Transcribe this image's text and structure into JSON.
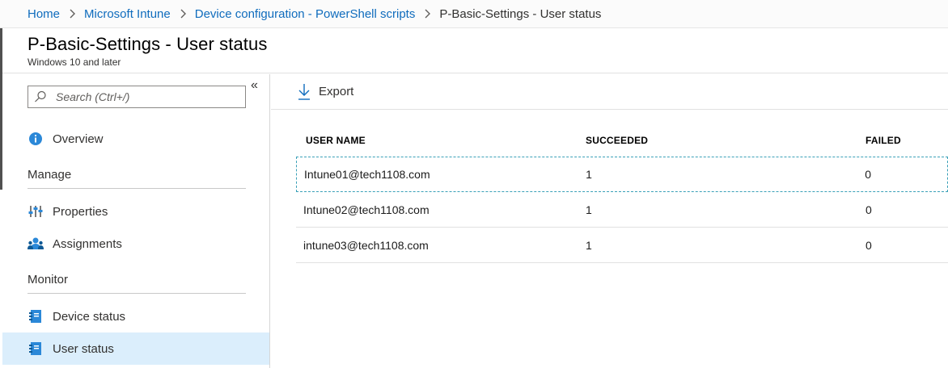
{
  "breadcrumb": {
    "items": [
      "Home",
      "Microsoft Intune",
      "Device configuration - PowerShell scripts",
      "P-Basic-Settings - User status"
    ]
  },
  "header": {
    "title": "P-Basic-Settings - User status",
    "subtitle": "Windows 10 and later"
  },
  "sidebar": {
    "search_placeholder": "Search (Ctrl+/)",
    "collapse_glyph": "«",
    "overview": "Overview",
    "manage_title": "Manage",
    "properties": "Properties",
    "assignments": "Assignments",
    "monitor_title": "Monitor",
    "device_status": "Device status",
    "user_status": "User status",
    "active_item": "User status"
  },
  "toolbar": {
    "export_label": "Export"
  },
  "table": {
    "columns": [
      "USER NAME",
      "SUCCEEDED",
      "FAILED"
    ],
    "rows": [
      {
        "user": "Intune01@tech1108.com",
        "succeeded": "1",
        "failed": "0"
      },
      {
        "user": "Intune02@tech1108.com",
        "succeeded": "1",
        "failed": "0"
      },
      {
        "user": "intune03@tech1108.com",
        "succeeded": "1",
        "failed": "0"
      }
    ]
  },
  "colors": {
    "link": "#0f6cbd",
    "active_bg": "#dbeefc",
    "icon_blue": "#2b88d8"
  }
}
